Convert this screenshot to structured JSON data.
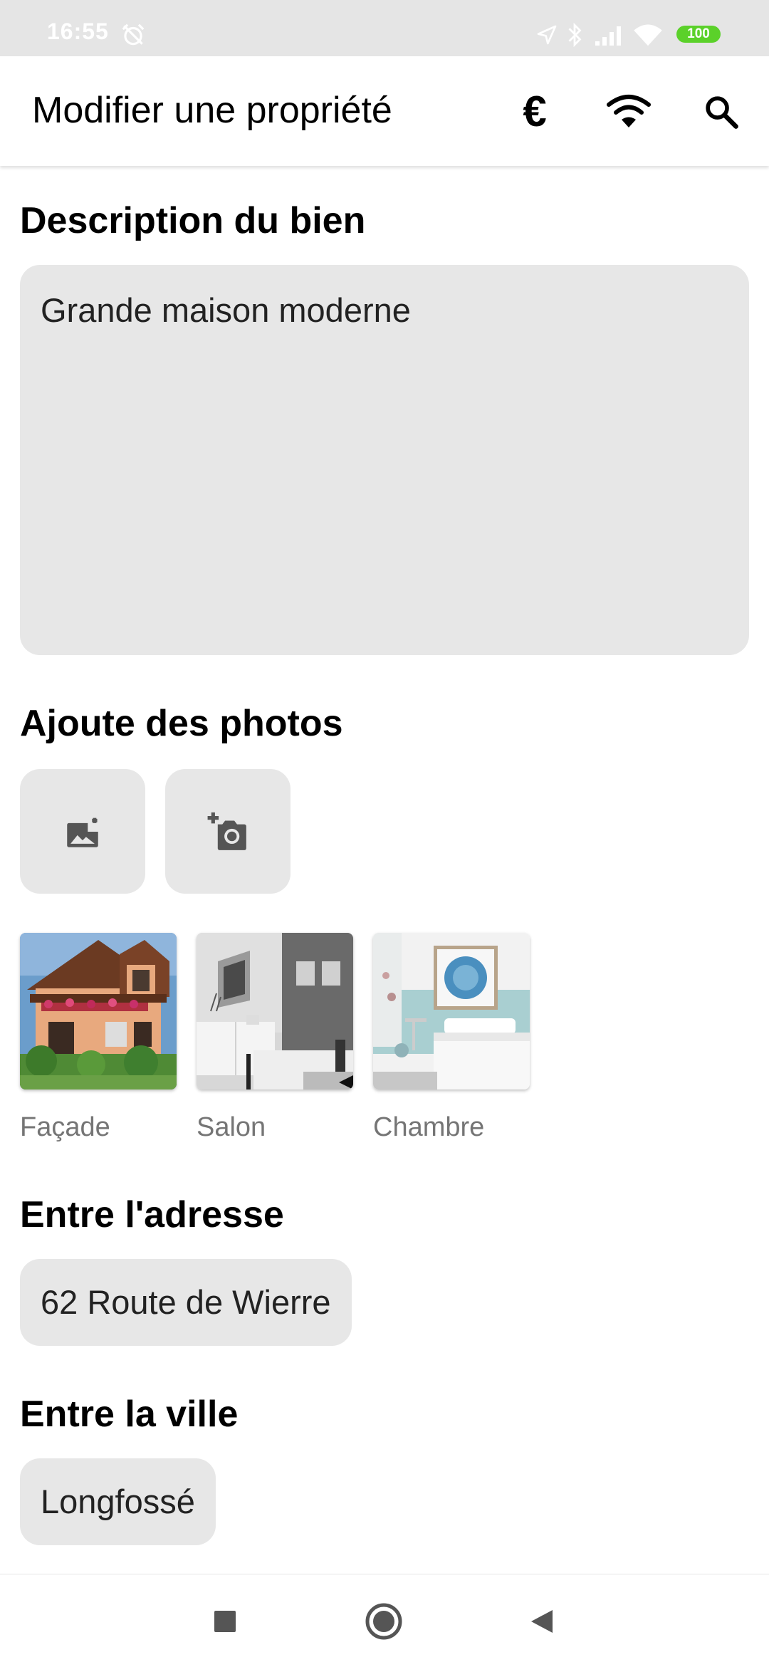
{
  "status_bar": {
    "time": "16:55",
    "battery": "100",
    "icons": [
      "alarm-off-icon",
      "location-icon",
      "bluetooth-icon",
      "signal-icon",
      "wifi-icon",
      "battery-icon"
    ]
  },
  "app_bar": {
    "title": "Modifier une propriété",
    "actions": [
      {
        "name": "euro",
        "icon": "euro-icon",
        "glyph": "€"
      },
      {
        "name": "wifi",
        "icon": "wifi-icon"
      },
      {
        "name": "search",
        "icon": "search-icon"
      }
    ]
  },
  "description": {
    "heading": "Description du bien",
    "value": "Grande maison moderne"
  },
  "photos": {
    "heading": "Ajoute des photos",
    "buttons": [
      {
        "name": "add-photo-from-gallery",
        "icon": "add-image-icon"
      },
      {
        "name": "add-photo-from-camera",
        "icon": "add-camera-icon"
      }
    ],
    "items": [
      {
        "label": "Façade"
      },
      {
        "label": "Salon"
      },
      {
        "label": "Chambre"
      }
    ]
  },
  "address": {
    "heading": "Entre l'adresse",
    "value": "62 Route de Wierre"
  },
  "city": {
    "heading": "Entre la ville",
    "value": "Longfossé"
  },
  "nav_bar": {
    "buttons": [
      {
        "name": "recents",
        "icon": "square-icon"
      },
      {
        "name": "home",
        "icon": "circle-icon"
      },
      {
        "name": "back",
        "icon": "triangle-back-icon"
      }
    ]
  },
  "colors": {
    "status_bar_bg": "#e5e5e5",
    "field_bg": "#e7e7e7",
    "battery": "#5bd12a",
    "caption": "#757575"
  }
}
